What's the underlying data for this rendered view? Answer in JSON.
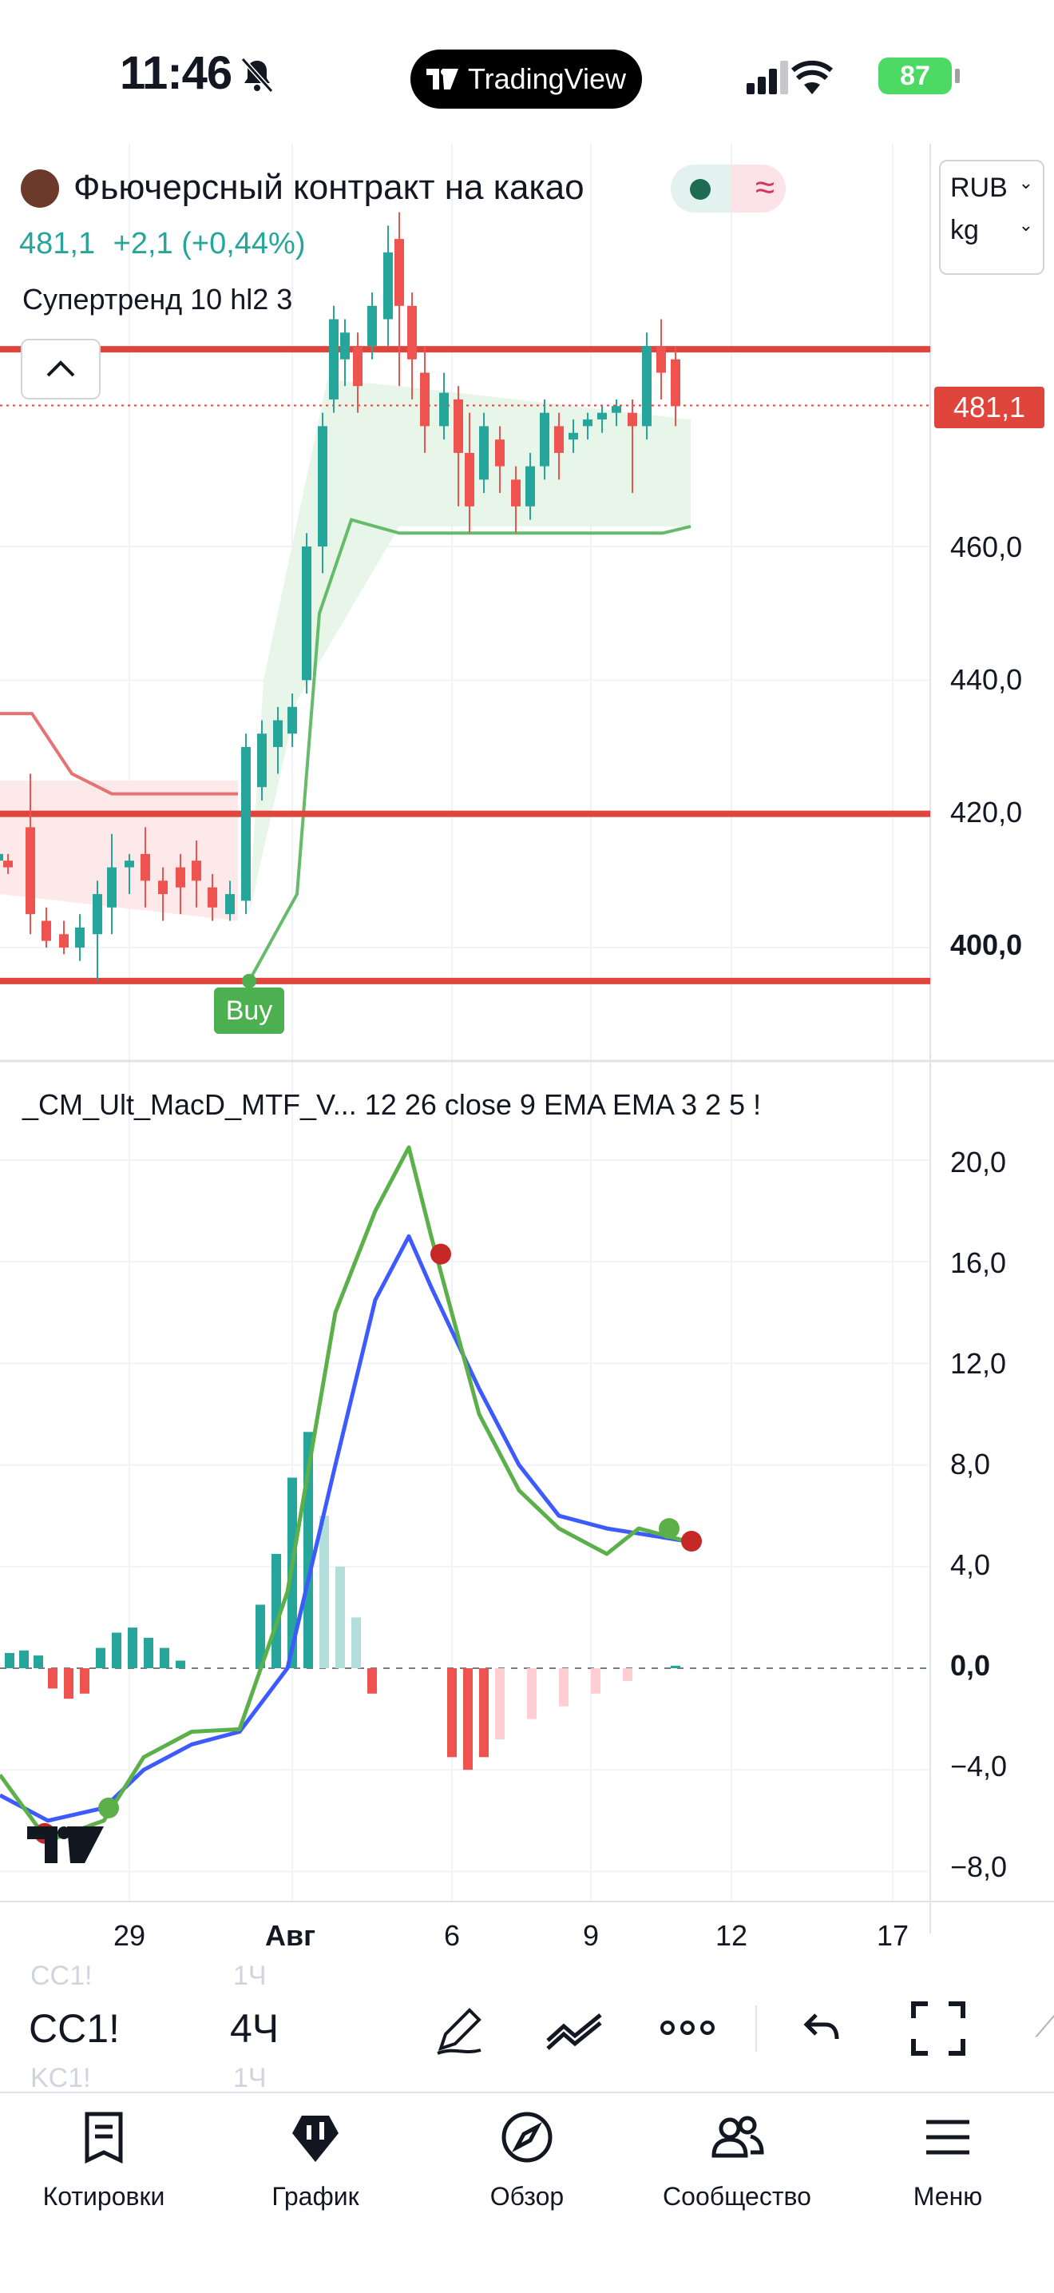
{
  "status_bar": {
    "time": "11:46",
    "app_badge": "TradingView",
    "battery": "87"
  },
  "header": {
    "symbol_name": "Фьючерсный контракт на какао",
    "price": "481,1",
    "change": "+2,1 (+0,44%)",
    "indicator_label": "Супертренд 10 hl2 3",
    "currency": "RUB",
    "unit": "kg"
  },
  "main_pane": {
    "last_price_tag": "481,1",
    "buy_label": "Buy",
    "y_ticks": [
      "460,0",
      "440,0",
      "420,0",
      "400,0"
    ]
  },
  "macd_pane": {
    "title": "_CM_Ult_MacD_MTF_V... 12 26 close 9 EMA EMA 3 2 5 !",
    "y_ticks": [
      "20,0",
      "16,0",
      "12,0",
      "8,0",
      "4,0",
      "0,0",
      "−4,0",
      "−8,0"
    ]
  },
  "x_axis": {
    "ticks": [
      "29",
      "Авг",
      "6",
      "9",
      "12",
      "17"
    ]
  },
  "toolbar": {
    "symbol": "CC1!",
    "interval": "4Ч",
    "ghost_symbol_top": "CC1!",
    "ghost_interval_top": "1Ч",
    "ghost_symbol_bottom": "KC1!",
    "ghost_interval_bottom": "1Ч"
  },
  "bottom_nav": {
    "items": [
      {
        "label": "Котировки"
      },
      {
        "label": "График"
      },
      {
        "label": "Обзор"
      },
      {
        "label": "Сообщество"
      },
      {
        "label": "Меню"
      }
    ]
  },
  "chart_data": {
    "type": "line",
    "title": "Фьючерсный контракт на какао",
    "x_ticks": [
      "29",
      "Авг",
      "6",
      "9",
      "12",
      "17"
    ],
    "price_axis": {
      "ylim": [
        392,
        508
      ],
      "ticks": [
        400,
        420,
        440,
        460
      ]
    },
    "horizontal_levels": [
      489.5,
      420.0,
      395.0
    ],
    "supertrend_down": [
      435,
      435,
      426,
      423,
      423,
      423,
      423,
      423
    ],
    "supertrend_up": [
      395,
      408,
      450,
      464,
      462,
      462,
      462,
      462,
      462,
      462,
      463
    ],
    "macd_axis": {
      "ylim": [
        -9,
        21
      ],
      "ticks": [
        20,
        16,
        12,
        8,
        4,
        0,
        -4,
        -8
      ]
    },
    "macd_series": [
      {
        "name": "MACD",
        "values": [
          -4.2,
          -6.8,
          -6.0,
          -3.5,
          -2.5,
          -2.4,
          3.0,
          14.0,
          18.0,
          20.5,
          17.0,
          10.0,
          7.0,
          5.5,
          4.5,
          5.5,
          5.0
        ]
      },
      {
        "name": "Signal",
        "values": [
          -5.0,
          -6.0,
          -5.5,
          -4.0,
          -3.0,
          -2.5,
          0.0,
          8.0,
          14.5,
          17.0,
          15.0,
          11.0,
          8.0,
          6.0,
          5.5,
          5.3,
          5.0
        ]
      }
    ],
    "histogram": [
      0.6,
      0.7,
      0.5,
      -0.8,
      -1.2,
      -1.0,
      0.8,
      1.4,
      1.6,
      1.2,
      0.8,
      0.3,
      2.5,
      4.5,
      7.5,
      9.3,
      6.0,
      4.0,
      2.0,
      -1.0,
      -3.5,
      -4.0,
      -3.5,
      -2.8,
      -2.0,
      -1.5,
      -1.0,
      -0.5,
      0.1
    ]
  }
}
